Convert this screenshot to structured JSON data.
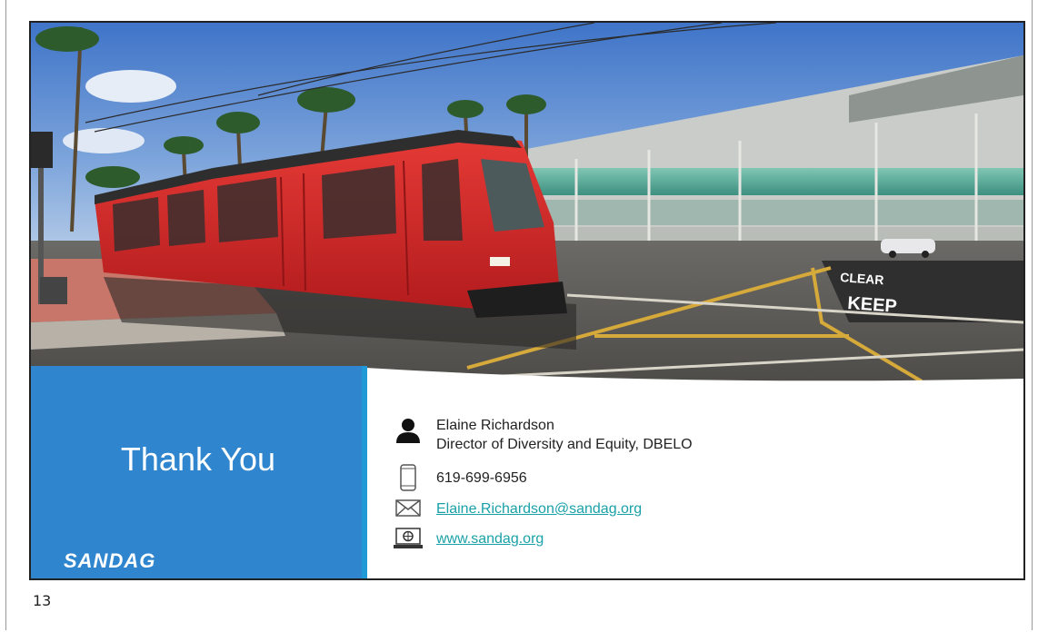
{
  "slide": {
    "thank_you": "Thank You",
    "logo": "SANDAG",
    "slide_number": "13",
    "photo": {
      "road_marking_1": "CLEAR",
      "road_marking_2": "KEEP"
    },
    "contact": {
      "name": "Elaine Richardson",
      "title": "Director of Diversity and Equity, DBELO",
      "phone": "619-699-6956",
      "email": "Elaine.Richardson@sandag.org",
      "website": "www.sandag.org"
    }
  },
  "colors": {
    "panel_blue": "#2f86cf",
    "link_teal": "#1aa1a8",
    "trolley_red": "#d8222a"
  },
  "icons": [
    "person-icon",
    "phone-icon",
    "envelope-icon",
    "laptop-globe-icon"
  ]
}
